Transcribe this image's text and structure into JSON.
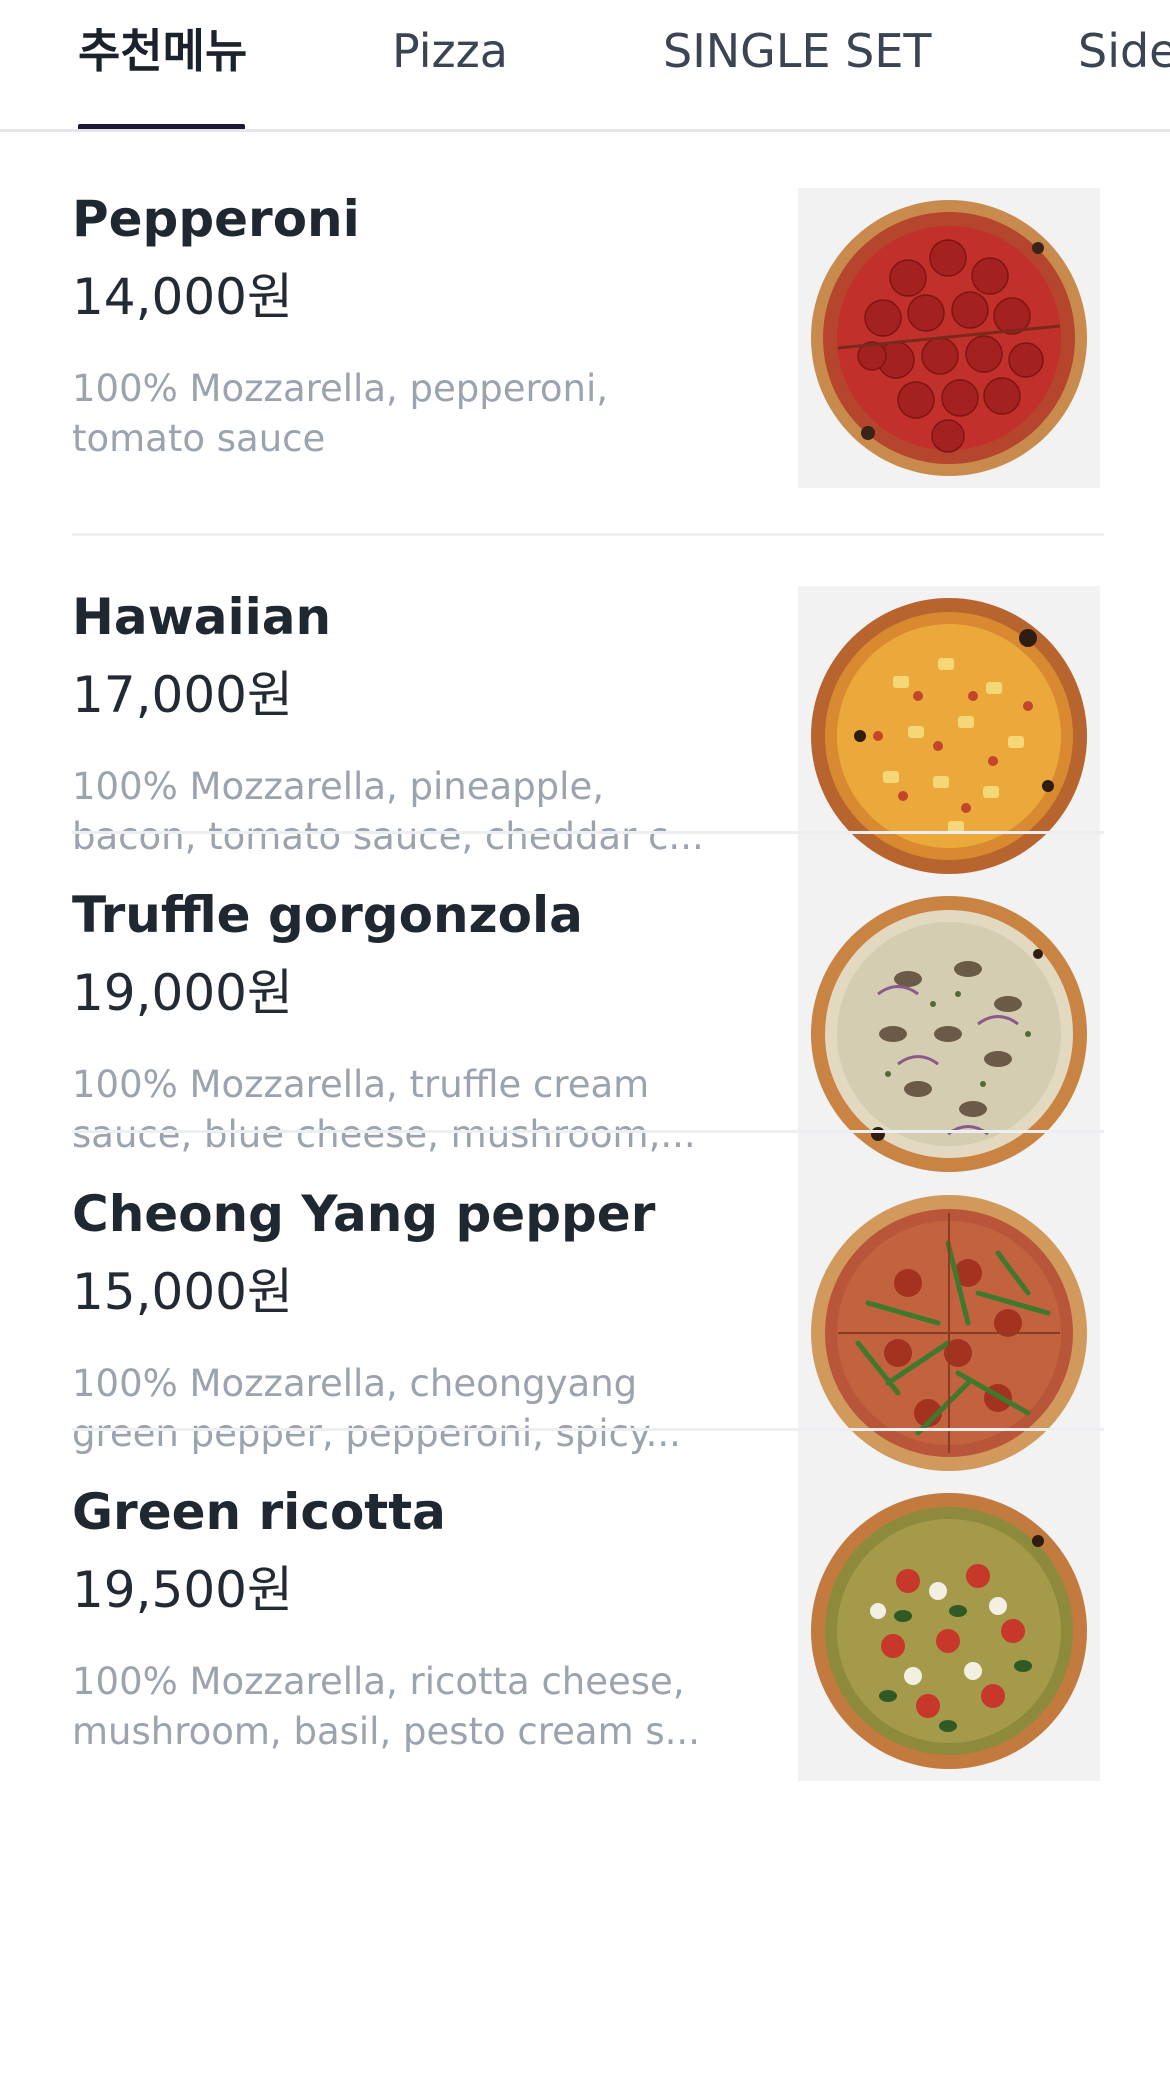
{
  "tabs": [
    {
      "label": "추천메뉴",
      "active": true
    },
    {
      "label": "Pizza",
      "active": false
    },
    {
      "label": "SINGLE SET",
      "active": false
    },
    {
      "label": "Side",
      "active": false
    }
  ],
  "colors": {
    "active_indicator": "#1a1833",
    "title": "#1f2730",
    "description": "#9aa3ae",
    "image_background": "#f2f2f2"
  },
  "menu_items": [
    {
      "name": "Pepperoni",
      "price": "14,000원",
      "description": "100% Mozzarella, pepperoni, tomato sauce",
      "image": "pepperoni-pizza-photo"
    },
    {
      "name": "Hawaiian",
      "price": "17,000원",
      "description": "100% Mozzarella, pineapple, bacon, tomato sauce, cheddar c...",
      "image": "hawaiian-pizza-photo"
    },
    {
      "name": "Truffle gorgonzola",
      "price": "19,000원",
      "description": "100% Mozzarella, truffle cream sauce, blue cheese, mushroom,...",
      "image": "truffle-gorgonzola-pizza-photo"
    },
    {
      "name": "Cheong Yang pepper",
      "price": "15,000원",
      "description": "100% Mozzarella, cheongyang green pepper, pepperoni, spicy...",
      "image": "cheong-yang-pepper-pizza-photo"
    },
    {
      "name": "Green ricotta",
      "price": "19,500원",
      "description": "100% Mozzarella, ricotta cheese, mushroom, basil, pesto cream s...",
      "image": "green-ricotta-pizza-photo"
    }
  ]
}
